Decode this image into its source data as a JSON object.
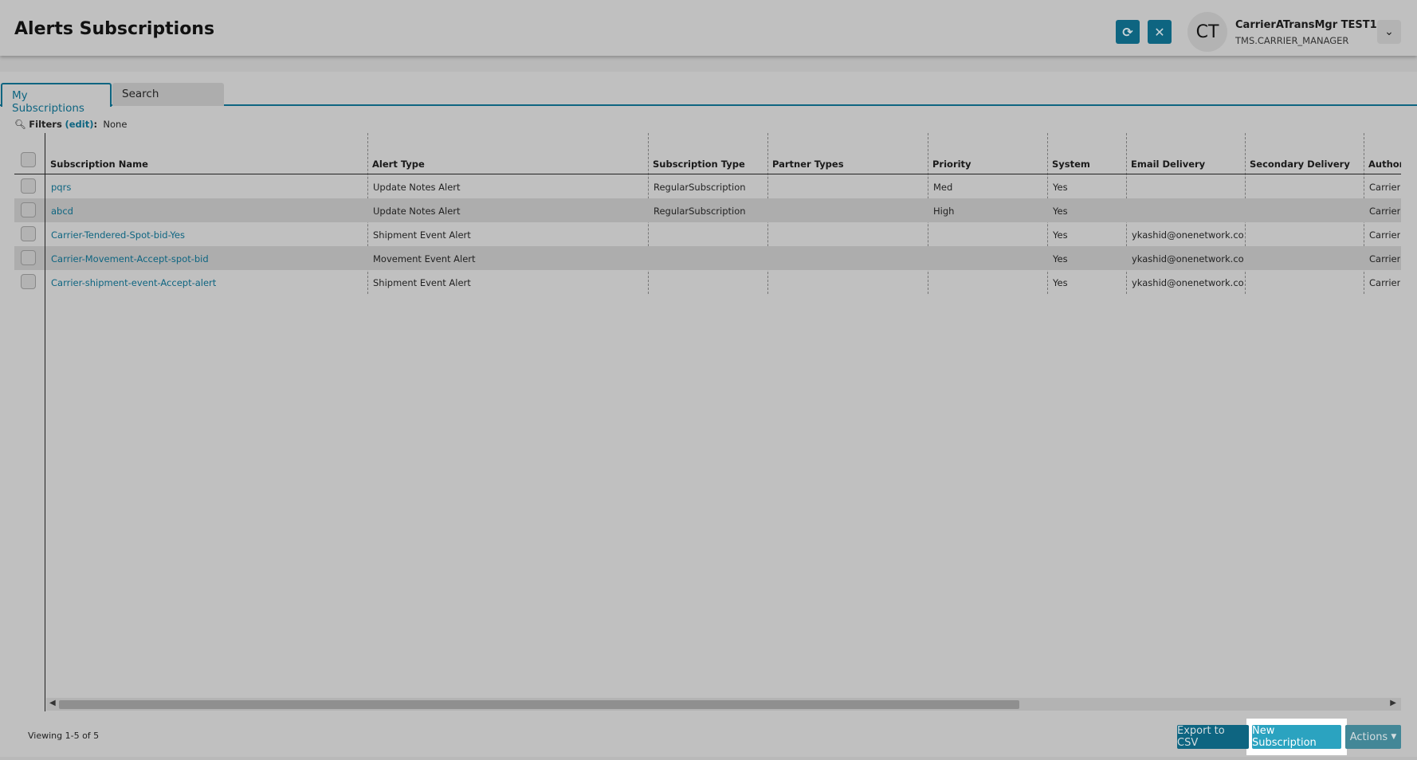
{
  "header": {
    "title": "Alerts Subscriptions",
    "refresh_icon": "refresh-icon",
    "close_icon": "close-icon",
    "user": {
      "initials": "CT",
      "name": "CarrierATransMgr TEST1",
      "role": "TMS.CARRIER_MANAGER"
    }
  },
  "tabs": [
    {
      "label": "My Subscriptions",
      "active": true
    },
    {
      "label": "Search",
      "active": false
    }
  ],
  "filters": {
    "label": "Filters",
    "edit": "(edit)",
    "colon": ":",
    "value": "None"
  },
  "table": {
    "columns": [
      "Subscription Name",
      "Alert Type",
      "Subscription Type",
      "Partner Types",
      "Priority",
      "System",
      "Email Delivery",
      "Secondary Delivery",
      "Author"
    ],
    "rows": [
      [
        "pqrs",
        "Update Notes Alert",
        "RegularSubscription",
        "",
        "Med",
        "Yes",
        "",
        "",
        "CarrierA"
      ],
      [
        "abcd",
        "Update Notes Alert",
        "RegularSubscription",
        "",
        "High",
        "Yes",
        "",
        "",
        "CarrierA"
      ],
      [
        "Carrier-Tendered-Spot-bid-Yes",
        "Shipment Event Alert",
        "",
        "",
        "",
        "Yes",
        "ykashid@onenetwork.com",
        "",
        "CarrierA"
      ],
      [
        "Carrier-Movement-Accept-spot-bid",
        "Movement Event Alert",
        "",
        "",
        "",
        "Yes",
        "ykashid@onenetwork.com",
        "",
        "CarrierA"
      ],
      [
        "Carrier-shipment-event-Accept-alert",
        "Shipment Event Alert",
        "",
        "",
        "",
        "Yes",
        "ykashid@onenetwork.com",
        "",
        "CarrierA"
      ]
    ]
  },
  "footer": {
    "viewing": "Viewing 1-5 of 5",
    "export": "Export to CSV",
    "new": "New Subscription",
    "actions": "Actions"
  },
  "colors": {
    "primary": "#0e6581",
    "highlight_button": "#2ba3c0"
  }
}
